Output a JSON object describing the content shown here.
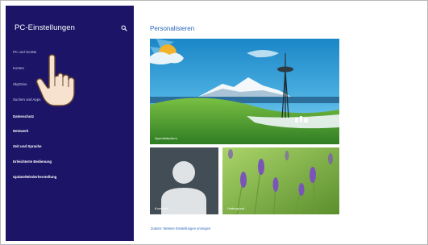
{
  "sidebar": {
    "title": "PC-Einstellungen",
    "items": [
      {
        "label": "PC und Geräte"
      },
      {
        "label": "Konten"
      },
      {
        "label": "SkyDrive"
      },
      {
        "label": "Suchen und Apps"
      },
      {
        "label": "Datenschutz"
      },
      {
        "label": "Netzwerk"
      },
      {
        "label": "Zeit und Sprache"
      },
      {
        "label": "Erleichterte Bedienung"
      },
      {
        "label": "Update/Wiederherstellung"
      }
    ]
  },
  "main": {
    "title": "Personalisieren",
    "tiles": {
      "lock_screen": {
        "label": "Sperrbildschirm"
      },
      "account_picture": {
        "label": "Kontobild"
      },
      "background": {
        "label": "Hintergrund"
      }
    },
    "more_settings_link": "Zudem: Weitere Einstellungen anzeigen"
  },
  "colors": {
    "sidebar_bg": "#1c1466",
    "accent": "#2b67b8"
  }
}
